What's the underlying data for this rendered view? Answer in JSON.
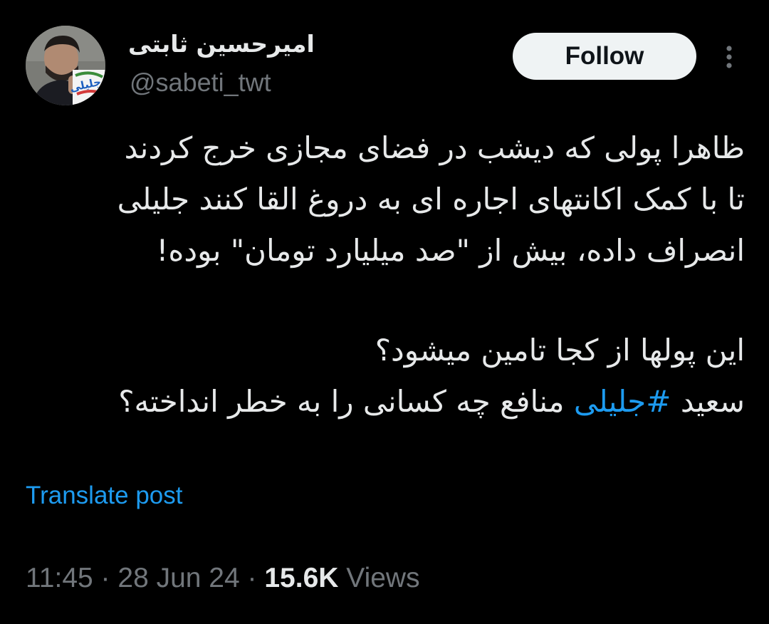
{
  "author": {
    "display_name": "امیرحسین ثابتی",
    "handle": "@sabeti_twt",
    "avatar_badge_text": "جلیلی"
  },
  "actions": {
    "follow_label": "Follow",
    "more_icon": "more-vertical-icon"
  },
  "tweet": {
    "lines": [
      "ظاهرا پولی که دیشب در فضای مجازی خرج کردند",
      "تا با کمک اکانتهای اجاره ای به دروغ القا کنند جلیلی",
      "انصراف داده، بیش از \"صد میلیارد تومان\" بوده!",
      "این پولها از کجا تامین میشود؟"
    ],
    "last_line_before": "سعید ",
    "hashtag": "#جلیلی",
    "last_line_after": " منافع چه کسانی را به خطر انداخته؟"
  },
  "translate_label": "Translate post",
  "meta": {
    "time": "11:45",
    "separator": " · ",
    "date": "28 Jun 24",
    "views_count": "15.6K",
    "views_label": " Views"
  },
  "colors": {
    "background": "#000000",
    "text": "#e7e9ea",
    "secondary": "#71767b",
    "accent": "#1d9bf0",
    "follow_bg": "#eff3f4"
  }
}
